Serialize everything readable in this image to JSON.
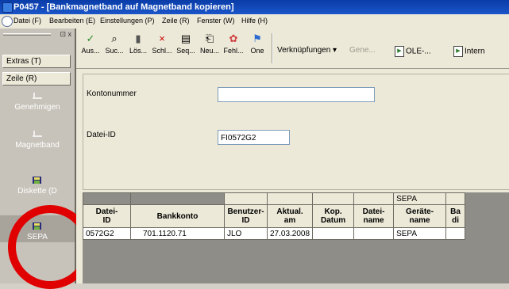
{
  "window": {
    "title": "P0457 - [Bankmagnetband auf Magnetband kopieren]"
  },
  "menu": [
    "Datei (F)",
    "Bearbeiten (E)",
    "Einstellungen (P)",
    "Zeile (R)",
    "Fenster (W)",
    "Hilfe (H)"
  ],
  "sidebar": {
    "dock_close": "⊡ x",
    "buttons": [
      "Extras (T)",
      "Zeile (R)"
    ],
    "items": [
      {
        "label": "Genehmigen",
        "icon": "pen-icon"
      },
      {
        "label": "Magnetband",
        "icon": "pen-icon"
      },
      {
        "label": "Diskette (D",
        "icon": "disk-icon"
      },
      {
        "label": "SEPA",
        "icon": "disk-icon"
      }
    ]
  },
  "toolbar": {
    "buttons": [
      {
        "label": "Aus...",
        "icon": "check-icon",
        "glyph": "✓",
        "color": "#2a8a2a"
      },
      {
        "label": "Suc...",
        "icon": "search-icon",
        "glyph": "⌕",
        "color": "#333333"
      },
      {
        "label": "Lös...",
        "icon": "trash-icon",
        "glyph": "▮",
        "color": "#555555"
      },
      {
        "label": "Schl...",
        "icon": "close-icon",
        "glyph": "×",
        "color": "#cc0000"
      },
      {
        "label": "Seq...",
        "icon": "document-icon",
        "glyph": "▤",
        "color": "#444444"
      },
      {
        "label": "Neu...",
        "icon": "new-icon",
        "glyph": "⎗",
        "color": "#444444"
      },
      {
        "label": "Fehl...",
        "icon": "error-icon",
        "glyph": "✿",
        "color": "#d04040"
      },
      {
        "label": "One",
        "icon": "one-icon",
        "glyph": "⚑",
        "color": "#2a6ad0"
      }
    ],
    "links": {
      "verknuepfungen": "Verknüpfungen ▾",
      "gene": "Gene...",
      "ole": "OLE-...",
      "intern": "Intern"
    }
  },
  "form": {
    "kontonummer_label": "Kontonummer",
    "kontonummer_value": "",
    "datei_id_label": "Datei-ID",
    "datei_id_value": "FI0572G2"
  },
  "grid": {
    "top_row": [
      "",
      "",
      "",
      "",
      "",
      "",
      "SEPA",
      ""
    ],
    "headers": [
      "Datei-\nID",
      "Bankkonto",
      "Benutzer-\nID",
      "Aktual.\nam",
      "Kop.\nDatum",
      "Datei-\nname",
      "Geräte-\nname",
      "Ba\ndi"
    ],
    "rows": [
      [
        "0572G2",
        "701.1120.71",
        "JLO",
        "27.03.2008",
        "",
        "",
        "SEPA",
        ""
      ]
    ]
  },
  "colors": {
    "title": "#0a3ca8",
    "highlight": "#e00000"
  }
}
